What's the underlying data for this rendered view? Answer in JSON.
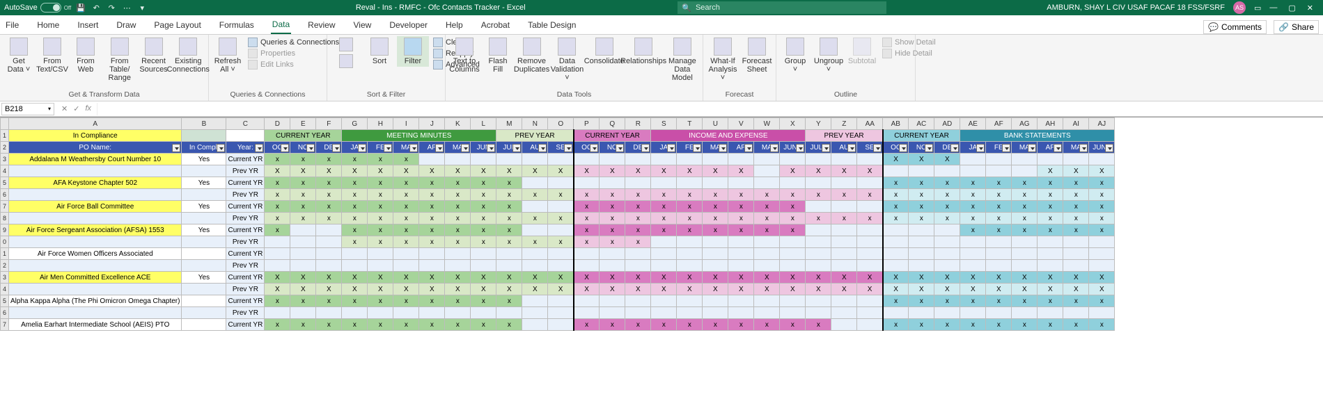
{
  "titlebar": {
    "autosave_label": "AutoSave",
    "autosave_state": "Off",
    "document_title": "Reval - Ins - RMFC - Ofc Contacts Tracker - Excel",
    "search_placeholder": "Search",
    "user_name": "AMBURN, SHAY L CIV USAF PACAF 18 FSS/FSRF",
    "user_initials": "AS"
  },
  "tabs": {
    "items": [
      "File",
      "Home",
      "Insert",
      "Draw",
      "Page Layout",
      "Formulas",
      "Data",
      "Review",
      "View",
      "Developer",
      "Help",
      "Acrobat",
      "Table Design"
    ],
    "active": "Data",
    "comments": "Comments",
    "share": "Share"
  },
  "ribbon": {
    "get_transform": {
      "get_data": "Get\nData ˅",
      "from_text": "From\nText/CSV",
      "from_web": "From\nWeb",
      "from_table": "From Table/\nRange",
      "recent": "Recent\nSources",
      "existing": "Existing\nConnections",
      "group_label": "Get & Transform Data"
    },
    "queries": {
      "refresh_all": "Refresh\nAll ˅",
      "queries_conn": "Queries & Connections",
      "properties": "Properties",
      "edit_links": "Edit Links",
      "group_label": "Queries & Connections"
    },
    "sort_filter": {
      "sort": "Sort",
      "filter": "Filter",
      "clear": "Clear",
      "reapply": "Reapply",
      "advanced": "Advanced",
      "group_label": "Sort & Filter"
    },
    "data_tools": {
      "text_cols": "Text to\nColumns",
      "flash_fill": "Flash\nFill",
      "remove_dup": "Remove\nDuplicates",
      "data_val": "Data\nValidation ˅",
      "consolidate": "Consolidate",
      "relationships": "Relationships",
      "manage_dm": "Manage\nData Model",
      "group_label": "Data Tools"
    },
    "forecast": {
      "whatif": "What-If\nAnalysis ˅",
      "forecast_sheet": "Forecast\nSheet",
      "group_label": "Forecast"
    },
    "outline": {
      "group": "Group\n˅",
      "ungroup": "Ungroup\n˅",
      "subtotal": "Subtotal",
      "show_detail": "Show Detail",
      "hide_detail": "Hide Detail",
      "group_label": "Outline"
    }
  },
  "namebox": {
    "cell_ref": "B218"
  },
  "sheet": {
    "col_letters": [
      "",
      "A",
      "B",
      "C",
      "D",
      "E",
      "F",
      "G",
      "H",
      "I",
      "J",
      "K",
      "L",
      "M",
      "N",
      "O",
      "P",
      "Q",
      "R",
      "S",
      "T",
      "U",
      "V",
      "W",
      "X",
      "Y",
      "Z",
      "AA",
      "AB",
      "AC",
      "AD",
      "AE",
      "AF",
      "AG",
      "AH",
      "AI",
      "AJ"
    ],
    "row1": {
      "in_compliance": "In Compliance",
      "cy_mm": "CURRENT YEAR",
      "mm_title": "MEETING MINUTES",
      "py_mm": "PREV YEAR",
      "cy_ie": "CURRENT YEAR",
      "ie_title": "INCOME AND EXPENSE",
      "py_ie": "PREV YEAR",
      "cy_bs": "CURRENT YEAR",
      "bs_title": "BANK STATEMENTS"
    },
    "row2": {
      "po_name": "PO Name:",
      "in_compliance": "In Compliance",
      "year": "Year:",
      "months_mm": [
        "OC",
        "NO",
        "DE",
        "JA",
        "FE",
        "MA",
        "AP",
        "MA",
        "JUN",
        "JUL",
        "AU",
        "SE"
      ],
      "months_ie": [
        "OC",
        "NO",
        "DE",
        "JA",
        "FE",
        "MA",
        "AP",
        "MA",
        "JUNE",
        "JULY",
        "AU",
        "SE"
      ],
      "months_bs": [
        "OC",
        "NO",
        "DE",
        "JA",
        "FE",
        "MA",
        "AP",
        "MA",
        "JUNE"
      ]
    },
    "rows": [
      {
        "num": 3,
        "name": "Addalana M Weathersby Court Number 10",
        "comp": "Yes",
        "year": "Current YR",
        "mm": [
          "x",
          "x",
          "x",
          "x",
          "x",
          "x",
          "",
          "",
          "",
          "",
          "",
          ""
        ],
        "ie": [
          "",
          "",
          "",
          "",
          "",
          "",
          "",
          "",
          "",
          "",
          "",
          ""
        ],
        "bs": [
          "X",
          "X",
          "X",
          "",
          "",
          "",
          "",
          "",
          ""
        ]
      },
      {
        "num": 4,
        "name": "",
        "comp": "",
        "year": "Prev YR",
        "mm": [
          "X",
          "X",
          "X",
          "X",
          "X",
          "X",
          "X",
          "X",
          "X",
          "X",
          "X",
          "X"
        ],
        "ie": [
          "X",
          "X",
          "X",
          "X",
          "X",
          "X",
          "X",
          "",
          "X",
          "X",
          "X",
          "X"
        ],
        "bs": [
          "",
          "",
          "",
          "",
          "",
          "",
          "X",
          "X",
          "X"
        ]
      },
      {
        "num": 5,
        "name": "AFA Keystone Chapter 502",
        "comp": "Yes",
        "year": "Current YR",
        "mm": [
          "x",
          "x",
          "x",
          "x",
          "x",
          "x",
          "x",
          "x",
          "x",
          "x",
          "",
          ""
        ],
        "ie": [
          "",
          "",
          "",
          "",
          "",
          "",
          "",
          "",
          "",
          "",
          "",
          ""
        ],
        "bs": [
          "x",
          "x",
          "x",
          "x",
          "x",
          "x",
          "x",
          "x",
          "x"
        ]
      },
      {
        "num": 6,
        "name": "",
        "comp": "",
        "year": "Prev YR",
        "mm": [
          "x",
          "x",
          "x",
          "x",
          "x",
          "x",
          "x",
          "x",
          "x",
          "x",
          "x",
          "x"
        ],
        "ie": [
          "x",
          "x",
          "x",
          "x",
          "x",
          "x",
          "x",
          "x",
          "x",
          "x",
          "x",
          "x"
        ],
        "bs": [
          "x",
          "x",
          "x",
          "x",
          "x",
          "x",
          "x",
          "x",
          "x"
        ]
      },
      {
        "num": 7,
        "name": "Air Force Ball Committee",
        "comp": "Yes",
        "year": "Current YR",
        "mm": [
          "x",
          "x",
          "x",
          "x",
          "x",
          "x",
          "x",
          "x",
          "x",
          "x",
          "",
          ""
        ],
        "ie": [
          "x",
          "x",
          "x",
          "x",
          "x",
          "x",
          "x",
          "x",
          "x",
          "",
          "",
          ""
        ],
        "bs": [
          "x",
          "x",
          "x",
          "x",
          "x",
          "x",
          "x",
          "x",
          "x"
        ]
      },
      {
        "num": 8,
        "name": "",
        "comp": "",
        "year": "Prev YR",
        "mm": [
          "x",
          "x",
          "x",
          "x",
          "x",
          "x",
          "x",
          "x",
          "x",
          "x",
          "x",
          "x"
        ],
        "ie": [
          "x",
          "x",
          "x",
          "x",
          "x",
          "x",
          "x",
          "x",
          "x",
          "x",
          "x",
          "x"
        ],
        "bs": [
          "x",
          "x",
          "x",
          "x",
          "x",
          "x",
          "x",
          "x",
          "x"
        ]
      },
      {
        "num": 9,
        "name": "Air Force Sergeant Association (AFSA) 1553",
        "comp": "Yes",
        "year": "Current YR",
        "mm": [
          "x",
          "",
          "",
          "x",
          "x",
          "x",
          "x",
          "x",
          "x",
          "x",
          "",
          ""
        ],
        "ie": [
          "x",
          "x",
          "x",
          "x",
          "x",
          "x",
          "x",
          "x",
          "x",
          "",
          "",
          ""
        ],
        "bs": [
          "",
          "",
          "",
          "x",
          "x",
          "x",
          "x",
          "x",
          "x"
        ]
      },
      {
        "num": 0,
        "name": "",
        "comp": "",
        "year": "Prev YR",
        "mm": [
          "",
          "",
          "",
          "x",
          "x",
          "x",
          "x",
          "x",
          "x",
          "x",
          "x",
          "x"
        ],
        "ie": [
          "x",
          "x",
          "x",
          "",
          "",
          "",
          "",
          "",
          "",
          "",
          "",
          ""
        ],
        "bs": [
          "",
          "",
          "",
          "",
          "",
          "",
          "",
          "",
          ""
        ]
      },
      {
        "num": 1,
        "name": "Air Force Women Officers Associated",
        "comp": "",
        "year": "Current YR",
        "mm": [
          "",
          "",
          "",
          "",
          "",
          "",
          "",
          "",
          "",
          "",
          "",
          ""
        ],
        "ie": [
          "",
          "",
          "",
          "",
          "",
          "",
          "",
          "",
          "",
          "",
          "",
          ""
        ],
        "bs": [
          "",
          "",
          "",
          "",
          "",
          "",
          "",
          "",
          ""
        ]
      },
      {
        "num": 2,
        "name": "",
        "comp": "",
        "year": "Prev YR",
        "mm": [
          "",
          "",
          "",
          "",
          "",
          "",
          "",
          "",
          "",
          "",
          "",
          ""
        ],
        "ie": [
          "",
          "",
          "",
          "",
          "",
          "",
          "",
          "",
          "",
          "",
          "",
          ""
        ],
        "bs": [
          "",
          "",
          "",
          "",
          "",
          "",
          "",
          "",
          ""
        ]
      },
      {
        "num": 3,
        "name": "Air Men Committed Excellence ACE",
        "comp": "Yes",
        "year": "Current YR",
        "mm": [
          "X",
          "X",
          "X",
          "X",
          "X",
          "X",
          "X",
          "X",
          "X",
          "X",
          "X",
          "X"
        ],
        "ie": [
          "X",
          "X",
          "X",
          "X",
          "X",
          "X",
          "X",
          "X",
          "X",
          "X",
          "X",
          "X"
        ],
        "bs": [
          "X",
          "X",
          "X",
          "X",
          "X",
          "X",
          "X",
          "X",
          "X"
        ]
      },
      {
        "num": 4,
        "name": "",
        "comp": "",
        "year": "Prev YR",
        "mm": [
          "X",
          "X",
          "X",
          "X",
          "X",
          "X",
          "X",
          "X",
          "X",
          "X",
          "X",
          "X"
        ],
        "ie": [
          "X",
          "X",
          "X",
          "X",
          "X",
          "X",
          "X",
          "X",
          "X",
          "X",
          "X",
          "X"
        ],
        "bs": [
          "X",
          "X",
          "X",
          "X",
          "X",
          "X",
          "X",
          "X",
          "X"
        ]
      },
      {
        "num": 5,
        "name": "Alpha Kappa Alpha (The Phi Omicron Omega Chapter)",
        "comp": "",
        "year": "Current YR",
        "mm": [
          "x",
          "x",
          "x",
          "x",
          "x",
          "x",
          "x",
          "x",
          "x",
          "x",
          "",
          ""
        ],
        "ie": [
          "",
          "",
          "",
          "",
          "",
          "",
          "",
          "",
          "",
          "",
          "",
          ""
        ],
        "bs": [
          "x",
          "x",
          "x",
          "x",
          "x",
          "x",
          "x",
          "x",
          "x"
        ]
      },
      {
        "num": 6,
        "name": "",
        "comp": "",
        "year": "Prev YR",
        "mm": [
          "",
          "",
          "",
          "",
          "",
          "",
          "",
          "",
          "",
          "",
          "",
          ""
        ],
        "ie": [
          "",
          "",
          "",
          "",
          "",
          "",
          "",
          "",
          "",
          "",
          "",
          ""
        ],
        "bs": [
          "",
          "",
          "",
          "",
          "",
          "",
          "",
          "",
          ""
        ]
      },
      {
        "num": 7,
        "name": "Amelia Earhart Intermediate School (AEIS) PTO",
        "comp": "",
        "year": "Current YR",
        "mm": [
          "x",
          "x",
          "x",
          "x",
          "x",
          "x",
          "x",
          "x",
          "x",
          "x",
          "",
          ""
        ],
        "ie": [
          "x",
          "x",
          "x",
          "x",
          "x",
          "x",
          "x",
          "x",
          "x",
          "x",
          "",
          ""
        ],
        "bs": [
          "x",
          "x",
          "x",
          "x",
          "x",
          "x",
          "x",
          "x",
          "x"
        ]
      }
    ]
  }
}
